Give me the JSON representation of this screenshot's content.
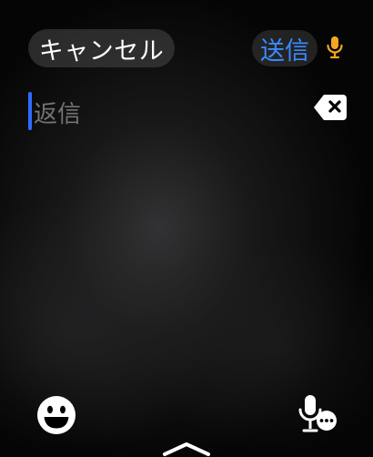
{
  "header": {
    "cancel_label": "キャンセル",
    "send_label": "送信",
    "mic_icon": "microphone-icon"
  },
  "reply": {
    "placeholder": "返信",
    "value": "",
    "delete_icon": "delete-backspace-icon"
  },
  "bottom": {
    "emoji_icon": "emoji-smiley-icon",
    "dictation_icon": "microphone-with-ellipsis-icon",
    "chevron_icon": "chevron-up-icon"
  },
  "colors": {
    "accent_blue": "#3a8bff",
    "cursor_blue": "#2f6bff",
    "mic_orange": "#f5a623",
    "placeholder_gray": "#737373",
    "button_bg": "#48484a"
  }
}
